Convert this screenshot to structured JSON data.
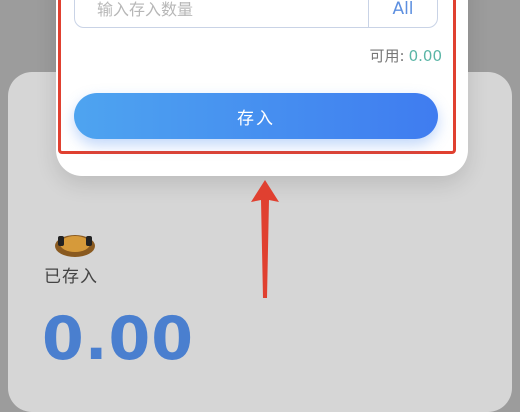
{
  "modal": {
    "amount_placeholder": "输入存入数量",
    "all_label": "All",
    "available_label": "可用:",
    "available_value": "0.00",
    "deposit_label": "存入"
  },
  "card": {
    "deposited_label": "已存入",
    "deposited_value": "0.00"
  },
  "annotation": {
    "icon": "up-arrow-icon",
    "color": "#e04030"
  },
  "colors": {
    "accent": "#4a7fcf",
    "button_start": "#4ea4f0",
    "button_end": "#3f7cf0",
    "available_value": "#5ab5a6"
  }
}
